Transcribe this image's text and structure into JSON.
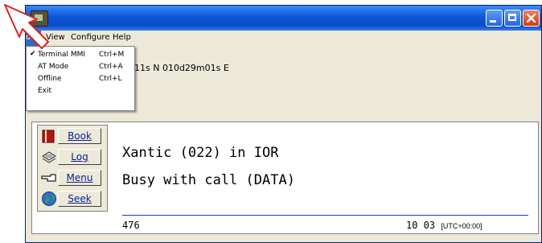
{
  "menubar": {
    "mode": "ode",
    "view": "View",
    "configure": "Configure",
    "help": "Help"
  },
  "mode_menu": {
    "items": [
      {
        "label": "Terminal MMI",
        "shortcut": "Ctrl+M",
        "check": "✔"
      },
      {
        "label": "AT Mode",
        "shortcut": "Ctrl+A",
        "check": ""
      },
      {
        "label": "Offline",
        "shortcut": "Ctrl+L",
        "check": ""
      },
      {
        "label": "Exit",
        "shortcut": "",
        "check": ""
      }
    ]
  },
  "position": {
    "text": "11s N 010d29m01s E"
  },
  "side_buttons": {
    "book": "Book",
    "log": "Log",
    "menu": "Menu",
    "seek": "Seek"
  },
  "display": {
    "line1": "Xantic (022) in IOR",
    "line2": "Busy with call (DATA)",
    "status_left": "476",
    "status_right": "10 03",
    "status_utc": "[UTC+00:00]"
  },
  "colors": {
    "title_bar": "#0b56d9",
    "menu_highlight": "#316ac5",
    "pointer": "#e02020",
    "divider": "#1a3cb0"
  }
}
